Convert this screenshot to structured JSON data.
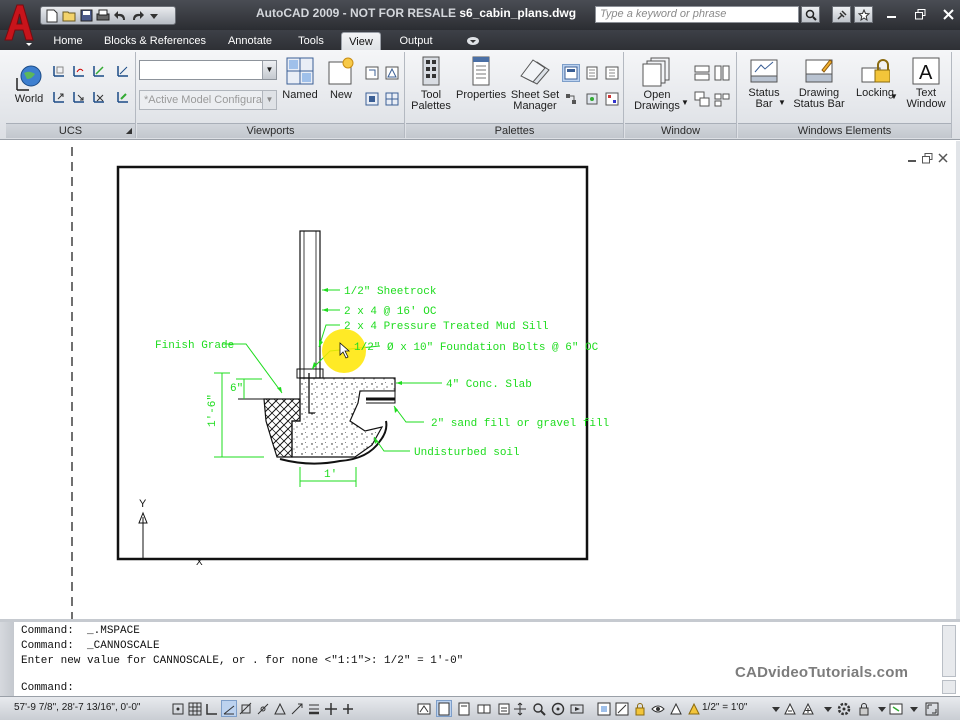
{
  "window": {
    "title_app": "AutoCAD 2009 - NOT FOR RESALE",
    "title_file": "s6_cabin_plans.dwg",
    "search_placeholder": "Type a keyword or phrase"
  },
  "ribbon": {
    "tabs": [
      {
        "label": "Home"
      },
      {
        "label": "Blocks & References"
      },
      {
        "label": "Annotate"
      },
      {
        "label": "Tools"
      },
      {
        "label": "View",
        "active": true
      },
      {
        "label": "Output"
      }
    ],
    "help_label": "?",
    "panels": {
      "ucs": {
        "title": "UCS",
        "world_label": "World"
      },
      "viewports": {
        "title": "Viewports",
        "config_text": "*Active Model Configurati",
        "named_label": "Named",
        "new_label": "New"
      },
      "palettes": {
        "title": "Palettes",
        "tool_palettes_label": [
          "Tool",
          "Palettes"
        ],
        "properties_label": "Properties",
        "sheet_set_label": [
          "Sheet Set",
          "Manager"
        ]
      },
      "window": {
        "title": "Window",
        "open_drawings_label": [
          "Open",
          "Drawings"
        ]
      },
      "windows_elements": {
        "title": "Windows Elements",
        "status_bar_label": [
          "Status",
          "Bar"
        ],
        "drawing_status_label": [
          "Drawing",
          "Status Bar"
        ],
        "locking_label": "Locking",
        "text_window_label": [
          "Text",
          "Window"
        ]
      }
    }
  },
  "drawing": {
    "callouts": [
      "1/2\" Sheetrock",
      "2 x 4 @ 16' OC",
      "2 x 4 Pressure Treated Mud Sill",
      "1/2\" Ø x 10\" Foundation Bolts @ 6\" OC",
      "4\" Conc. Slab",
      "2\" sand fill or gravel fill",
      "Undisturbed soil",
      "Finish Grade"
    ],
    "dimensions": [
      "6\"",
      "1'-6\"",
      "1'"
    ],
    "ucs_labels": [
      "Y",
      "X"
    ]
  },
  "command_line": {
    "lines": [
      "Command:  _.MSPACE",
      "Command:  _CANNOSCALE",
      "Enter new value for CANNOSCALE, or . for none <\"1:1\">: 1/2\" = 1'-0\""
    ],
    "prompt": "Command:",
    "watermark": "CADvideoTutorials.com"
  },
  "status_bar": {
    "coordinates": "57'-9 7/8\",  28'-7 13/16\", 0'-0\"",
    "annotation_scale": "1/2\" = 1'0\""
  },
  "colors": {
    "annotation_green": "#1edc1e",
    "linework": "#111111",
    "cursor_highlight": "#ffe600"
  }
}
